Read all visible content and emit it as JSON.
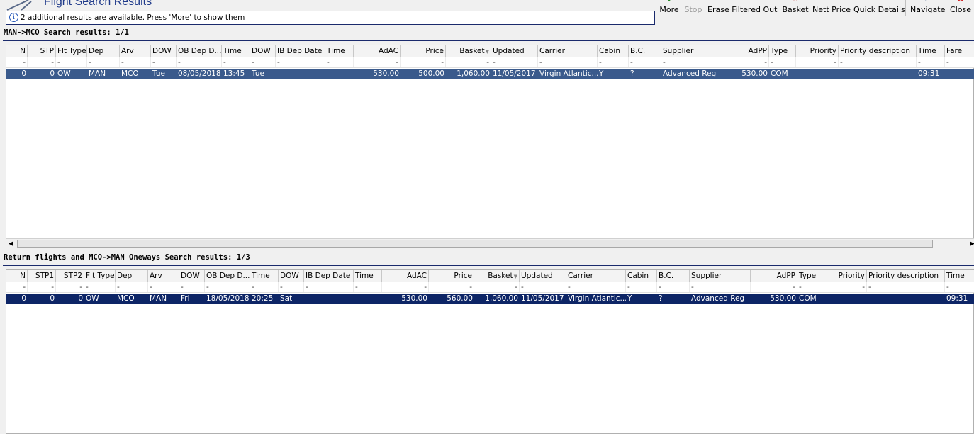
{
  "header": {
    "title": "Flight Search Results",
    "info": "2 additional results are available. Press 'More' to show them"
  },
  "toolbar": {
    "more": "More",
    "stop": "Stop",
    "erase": "Erase Filtered Out",
    "basket": "Basket",
    "nett_price": "Nett Price",
    "quick_details": "Quick Details",
    "navigate": "Navigate",
    "close": "Close"
  },
  "outbound": {
    "title": "MAN->MCO Search results: 1/1",
    "columns": [
      "N",
      "STP",
      "Flt Type",
      "Dep",
      "Arv",
      "DOW",
      "OB Dep D...",
      "Time",
      "DOW",
      "IB Dep Date",
      "Time",
      "AdAC",
      "Price",
      "Basket",
      "Updated",
      "Carrier",
      "Cabin",
      "B.C.",
      "Supplier",
      "AdPP",
      "Type",
      "Priority",
      "Priority description",
      "Time",
      "Fare"
    ],
    "filters": [
      "-",
      "-",
      "-",
      "-",
      "-",
      "-",
      "-",
      "-",
      "-",
      "-",
      "-",
      "-",
      "-",
      "-",
      "-",
      "-",
      "-",
      "-",
      "-",
      "-",
      "-",
      "-",
      "-",
      "-",
      "-"
    ],
    "rows": [
      [
        "0",
        "0",
        "OW",
        "MAN",
        "MCO",
        "Tue",
        "08/05/2018",
        "13:45",
        "Tue",
        "",
        "",
        "530.00",
        "500.00",
        "1,060.00",
        "11/05/2017",
        "Virgin Atlantic...",
        "Y",
        "?",
        "Advanced Reg",
        "530.00",
        "COM",
        "",
        "",
        "09:31",
        ""
      ]
    ]
  },
  "returns": {
    "title": "Return flights and MCO->MAN Oneways Search results: 1/3",
    "columns": [
      "N",
      "STP1",
      "STP2",
      "Flt Type",
      "Dep",
      "Arv",
      "DOW",
      "OB Dep D...",
      "Time",
      "DOW",
      "IB Dep Date",
      "Time",
      "AdAC",
      "Price",
      "Basket",
      "Updated",
      "Carrier",
      "Cabin",
      "B.C.",
      "Supplier",
      "AdPP",
      "Type",
      "Priority",
      "Priority description",
      "Time"
    ],
    "filters": [
      "-",
      "-",
      "-",
      "-",
      "-",
      "-",
      "-",
      "-",
      "-",
      "-",
      "-",
      "-",
      "-",
      "-",
      "-",
      "-",
      "-",
      "-",
      "-",
      "-",
      "-",
      "-",
      "-",
      "-",
      "-"
    ],
    "rows": [
      [
        "0",
        "0",
        "0",
        "OW",
        "MCO",
        "MAN",
        "Fri",
        "18/05/2018",
        "20:25",
        "Sat",
        "",
        "",
        "530.00",
        "560.00",
        "1,060.00",
        "11/05/2017",
        "Virgin Atlantic...",
        "Y",
        "?",
        "Advanced Reg",
        "530.00",
        "COM",
        "",
        "",
        "09:31"
      ]
    ]
  },
  "colors": {
    "selected_row_top": "#3a5a8c",
    "selected_row_bottom": "#0d2566"
  }
}
